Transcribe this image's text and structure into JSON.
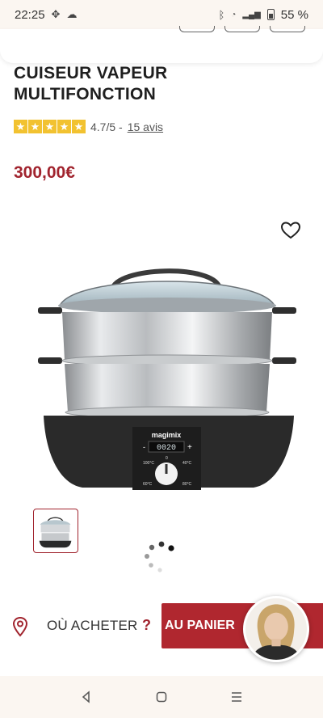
{
  "status_bar": {
    "time": "22:25",
    "battery": "55 %",
    "icons": [
      "fan-icon",
      "cloud-icon",
      "bluetooth-icon",
      "wifi-icon",
      "signal-icon",
      "battery-icon"
    ]
  },
  "product": {
    "title_line1": "CUISEUR VAPEUR",
    "title_line2": "MULTIFONCTION",
    "rating": 4.7,
    "rating_text": "4.7/5 -",
    "reviews_link": "15 avis",
    "price": "300,00€",
    "image": {
      "brand": "magimix",
      "display": "0020",
      "minus": "-",
      "plus": "+",
      "dial_labels": [
        "100°C",
        "80°C",
        "60°C",
        "40°C",
        "0"
      ]
    }
  },
  "actions": {
    "where_to_buy": "OÙ ACHETER",
    "question_mark": "?",
    "add_to_cart": "AU PANIER"
  },
  "colors": {
    "accent": "#b0272f",
    "price": "#a1242e",
    "star": "#f2c230",
    "system_bar": "#fbf6f1"
  },
  "nav": {
    "icons": [
      "back-icon",
      "home-icon",
      "recents-icon"
    ]
  }
}
